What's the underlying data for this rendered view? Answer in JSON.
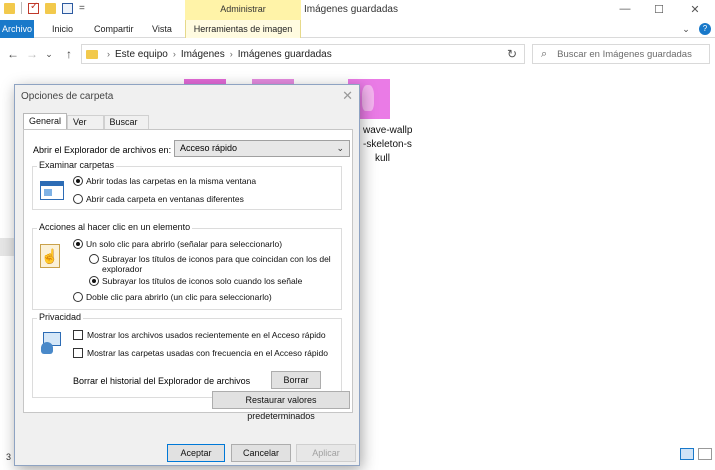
{
  "window": {
    "title": "Imágenes guardadas",
    "contextual_group": "Administrar",
    "controls": {
      "minimize": "—",
      "maximize": "☐",
      "close": "✕"
    }
  },
  "ribbon": {
    "tabs": [
      "Archivo",
      "Inicio",
      "Compartir",
      "Vista",
      "Herramientas de imagen"
    ],
    "expand_icon": "⌄",
    "help_icon": "?"
  },
  "navigation": {
    "back": "←",
    "forward": "→",
    "recent": "⌄",
    "up": "↑",
    "address_path": [
      "Este equipo",
      "Imágenes",
      "Imágenes guardadas"
    ],
    "refresh": "↻",
    "search_placeholder": "Buscar en Imágenes guardadas"
  },
  "files": {
    "visible_name_lines": [
      "wave-wallp",
      "-skeleton-s",
      "kull"
    ]
  },
  "status": {
    "item_count": "3"
  },
  "dialog": {
    "title": "Opciones de carpeta",
    "close": "✕",
    "tabs": [
      "General",
      "Ver",
      "Buscar"
    ],
    "open_explorer_label": "Abrir el Explorador de archivos en:",
    "open_explorer_value": "Acceso rápido",
    "browse": {
      "title": "Examinar carpetas",
      "options": [
        "Abrir todas las carpetas en la misma ventana",
        "Abrir cada carpeta en ventanas diferentes"
      ],
      "selected_index": 0
    },
    "click": {
      "title": "Acciones al hacer clic en un elemento",
      "single_click": "Un solo clic para abrirlo (señalar para seleccionarlo)",
      "underline_browser": "Subrayar los títulos de iconos para que coincidan con los del explorador",
      "underline_point": "Subrayar los títulos de iconos solo cuando los señale",
      "double_click": "Doble clic para abrirlo (un clic para seleccionarlo)",
      "selected_mode": "single",
      "selected_underline": "point"
    },
    "privacy": {
      "title": "Privacidad",
      "show_recent_files": "Mostrar los archivos usados recientemente en el Acceso rápido",
      "show_frequent_folders": "Mostrar las carpetas usadas con frecuencia en el Acceso rápido",
      "show_recent_files_checked": false,
      "show_frequent_folders_checked": false,
      "clear_history_label": "Borrar el historial del Explorador de archivos",
      "clear_button": "Borrar"
    },
    "restore_defaults": "Restaurar valores predeterminados",
    "buttons": {
      "ok": "Aceptar",
      "cancel": "Cancelar",
      "apply": "Aplicar"
    }
  }
}
